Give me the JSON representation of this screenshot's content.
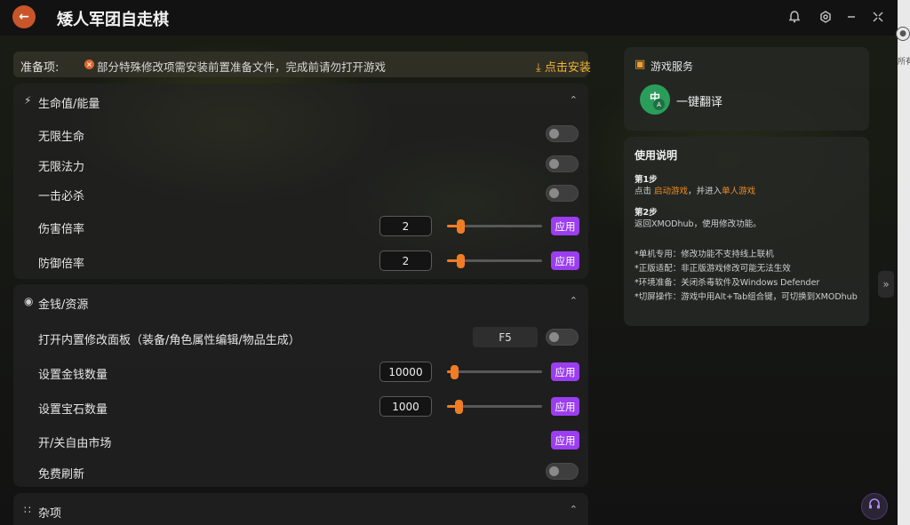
{
  "app": {
    "title": "矮人军团自走棋",
    "back_icon": "arrow-left-icon"
  },
  "titlebar_icons": [
    "bell-icon",
    "gear-icon",
    "minimize-icon",
    "collapse-icon"
  ],
  "right_strip": {
    "text": "所有"
  },
  "notice": {
    "label": "准备项:",
    "icon": "close-circle-icon",
    "text": "部分特殊修改项需安装前置准备文件，完成前请勿打开游戏",
    "install_label": "点击安装",
    "install_icon": "download-icon"
  },
  "sections": {
    "health": {
      "title": "生命值/能量",
      "icon": "lightning-icon",
      "rows": {
        "infinite_life": "无限生命",
        "infinite_mana": "无限法力",
        "one_hit_kill": "一击必杀",
        "damage_mult": {
          "label": "伤害倍率",
          "value": "2",
          "slider_fraction": 0.1,
          "apply": "应用"
        },
        "defense_mult": {
          "label": "防御倍率",
          "value": "2",
          "slider_fraction": 0.1,
          "apply": "应用"
        }
      }
    },
    "money": {
      "title": "金钱/资源",
      "icon": "coins-icon",
      "rows": {
        "builtin_panel": {
          "label": "打开内置修改面板（装备/角色属性编辑/物品生成）",
          "hotkey": "F5"
        },
        "set_gold": {
          "label": "设置金钱数量",
          "value": "10000",
          "slider_fraction": 0.0,
          "apply": "应用"
        },
        "set_gems": {
          "label": "设置宝石数量",
          "value": "1000",
          "slider_fraction": 0.08,
          "apply": "应用"
        },
        "free_market": {
          "label": "开/关自由市场",
          "apply": "应用"
        },
        "free_refresh": "免费刷新"
      }
    },
    "misc": {
      "title": "杂项",
      "icon": "grid-icon"
    }
  },
  "game_services": {
    "title": "游戏服务",
    "icon": "cube-icon",
    "translate": {
      "label": "一键翻译",
      "icon_main": "中",
      "icon_sub": "A"
    }
  },
  "instructions": {
    "title": "使用说明",
    "step1_title": "第1步",
    "step1_pre": "点击 ",
    "step1_link1": "启动游戏",
    "step1_mid": "，并进入",
    "step1_link2": "单人游戏",
    "step2_title": "第2步",
    "step2_text": "返回XMODhub，使用修改功能。",
    "notes": [
      "*单机专用：修改功能不支持线上联机",
      "*正版适配：非正版游戏修改可能无法生效",
      "*环境准备：关闭杀毒软件及Windows Defender",
      "*切屏操作：游戏中用Alt+Tab组合键，可切换到XMODhub"
    ]
  },
  "colors": {
    "accent_orange": "#f07d24",
    "apply_purple": "#9b3df0",
    "install_gold": "#f1b434"
  }
}
